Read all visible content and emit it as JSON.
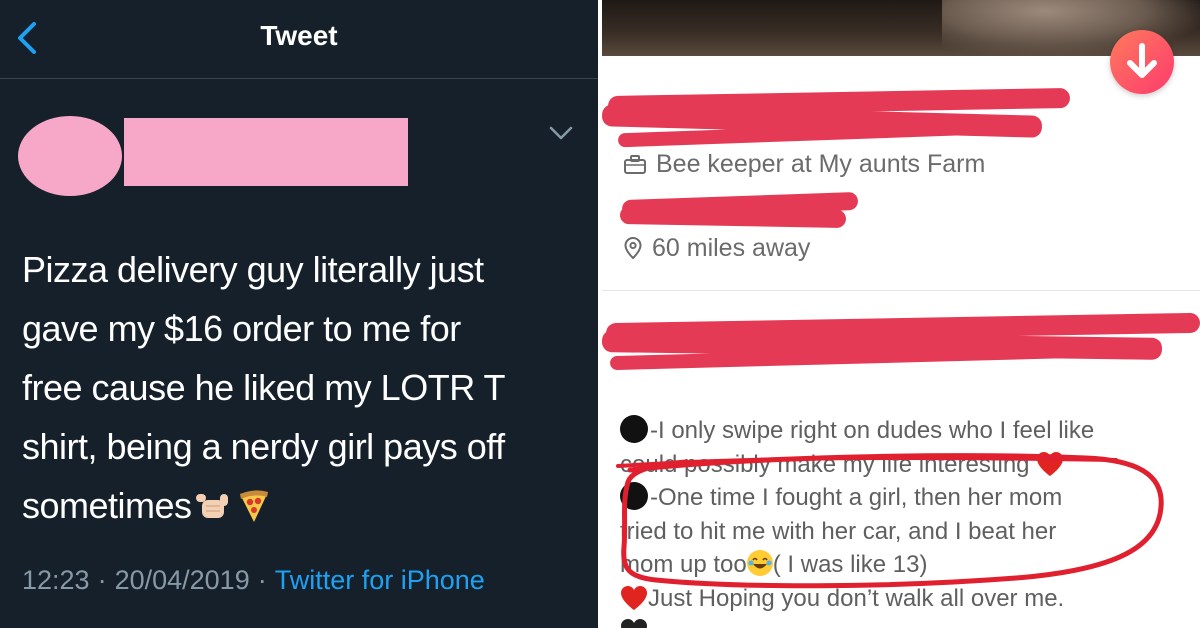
{
  "tweet": {
    "header_title": "Tweet",
    "text_lines": [
      "Pizza delivery guy literally just",
      "gave my $16 order to me for",
      "free cause he liked my LOTR T",
      "shirt, being a nerdy girl pays off",
      "sometimes"
    ],
    "time": "12:23",
    "date": "20/04/2019",
    "separator": "·",
    "source": "Twitter for iPhone",
    "colors": {
      "background": "#15202b",
      "text": "#ffffff",
      "meta": "#8899a6",
      "link": "#1da1f2",
      "redaction": "#f7a8c8"
    },
    "icons": [
      "back-chevron-icon",
      "caret-down-icon",
      "call-me-hand-emoji",
      "pizza-emoji"
    ]
  },
  "profile": {
    "job": "Bee keeper at My aunts Farm",
    "distance": "60 miles away",
    "bio_lines": {
      "l1": "-I only swipe right on dudes who I feel like",
      "l2": "could possibly make my life interesting",
      "l3": "-One time I fought  a girl, then her mom",
      "l4": "tried to hit me with her car, and I beat her",
      "l5a": "mom up too",
      "l5b": "( I was like 13)",
      "l6": "Just Hoping you don’t walk all over me."
    },
    "colors": {
      "redaction": "#e53a56",
      "accent": "#fd3b6e",
      "text": "#5f5f5f"
    },
    "icons": [
      "briefcase-icon",
      "location-pin-icon",
      "arrow-down-icon",
      "black-circle-emoji",
      "red-heart-emoji",
      "laughing-emoji"
    ]
  }
}
